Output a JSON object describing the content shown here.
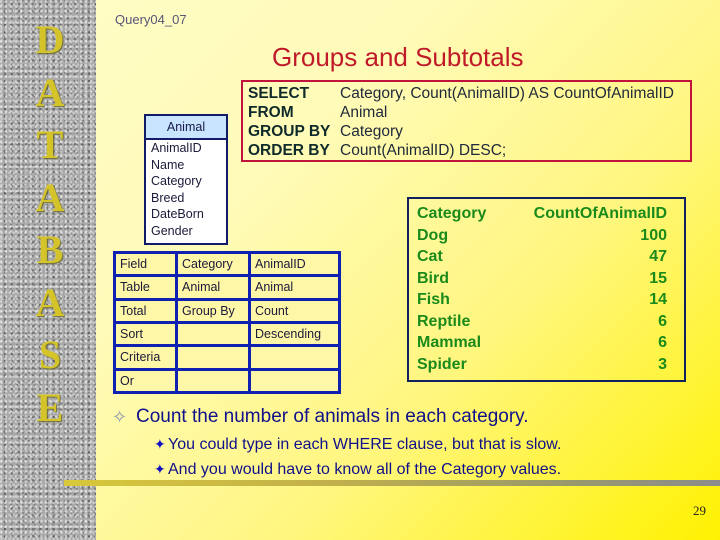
{
  "sidebar": {
    "letters": [
      "D",
      "A",
      "T",
      "A",
      "B",
      "A",
      "S",
      "E"
    ]
  },
  "query_name": "Query04_07",
  "title": "Groups and Subtotals",
  "sql": [
    {
      "keyword": "SELECT",
      "value": "Category, Count(AnimalID) AS CountOfAnimalID"
    },
    {
      "keyword": "FROM",
      "value": "Animal"
    },
    {
      "keyword": "GROUP BY",
      "value": "Category"
    },
    {
      "keyword": "ORDER BY",
      "value": "Count(AnimalID) DESC;"
    }
  ],
  "entity": {
    "name": "Animal",
    "fields": [
      "AnimalID",
      "Name",
      "Category",
      "Breed",
      "DateBorn",
      "Gender"
    ]
  },
  "design_grid": {
    "rows": [
      [
        "Field",
        "Category",
        "AnimalID"
      ],
      [
        "Table",
        "Animal",
        "Animal"
      ],
      [
        "Total",
        "Group By",
        "Count"
      ],
      [
        "Sort",
        "",
        "Descending"
      ],
      [
        "Criteria",
        "",
        ""
      ],
      [
        "Or",
        "",
        ""
      ]
    ]
  },
  "result": {
    "headers": [
      "Category",
      "CountOfAnimalID"
    ],
    "rows": [
      [
        "Dog",
        "100"
      ],
      [
        "Cat",
        "47"
      ],
      [
        "Bird",
        "15"
      ],
      [
        "Fish",
        "14"
      ],
      [
        "Reptile",
        "6"
      ],
      [
        "Mammal",
        "6"
      ],
      [
        "Spider",
        "3"
      ]
    ]
  },
  "bullets": {
    "main": "Count the number of animals in each category.",
    "main_marker": "✧",
    "sub_marker": "✦",
    "sub": [
      "You could type in each WHERE clause, but that is slow.",
      "And you would have to know all of the Category values."
    ]
  },
  "page_number": "29",
  "colors": {
    "title": "#c01a2a",
    "result_text": "#1a8a1a",
    "bullet_text": "#10108a",
    "grid_border": "#1020b0",
    "sql_border": "#c0143c"
  }
}
